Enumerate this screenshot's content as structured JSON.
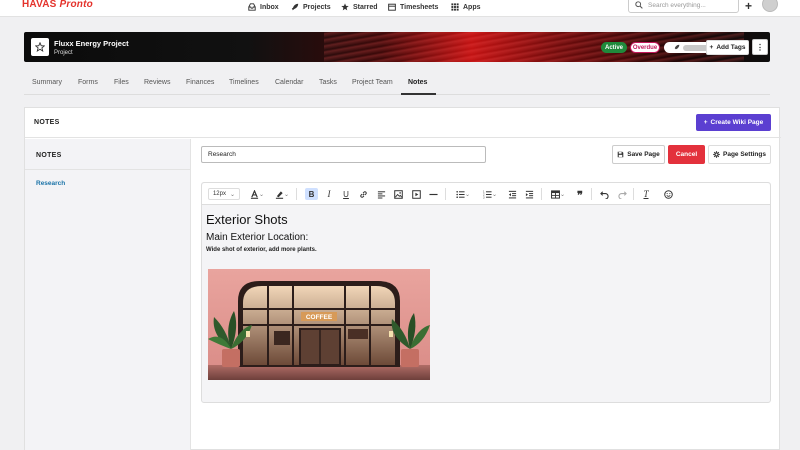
{
  "app": {
    "brand": "HAVAS",
    "product": "Pronto"
  },
  "topnav": {
    "items": [
      {
        "label": "Inbox",
        "icon": "inbox-icon"
      },
      {
        "label": "Projects",
        "icon": "rocket-icon"
      },
      {
        "label": "Starred",
        "icon": "star-icon"
      },
      {
        "label": "Timesheets",
        "icon": "timesheet-icon"
      },
      {
        "label": "Apps",
        "icon": "grid-icon"
      }
    ],
    "search_placeholder": "Search everything..."
  },
  "project": {
    "title": "Fluxx Energy Project",
    "subtitle": "Project",
    "status_active": "Active",
    "status_overdue": "Overdue",
    "add_tags_label": "Add Tags"
  },
  "tabs": [
    "Summary",
    "Forms",
    "Files",
    "Reviews",
    "Finances",
    "Timelines",
    "Calendar",
    "Tasks",
    "Project Team",
    "Notes"
  ],
  "active_tab": "Notes",
  "notes": {
    "panel_title": "NOTES",
    "create_label": "Create Wiki Page",
    "sidebar_title": "NOTES",
    "sidebar_items": [
      "Research"
    ],
    "page_title_value": "Research",
    "save_label": "Save Page",
    "cancel_label": "Cancel",
    "settings_label": "Page Settings"
  },
  "editor": {
    "font_size": "12px",
    "heading1": "Exterior Shots",
    "heading2": "Main Exterior Location:",
    "paragraph": "Wide shot of exterior, add more plants.",
    "image_sign": "COFFEE"
  },
  "colors": {
    "brand_red": "#e4322b",
    "primary": "#5b3fd1",
    "danger": "#e3313c",
    "active_green": "#1f8a3b",
    "overdue_pink": "#c2185b",
    "link_blue": "#1a73a8"
  }
}
